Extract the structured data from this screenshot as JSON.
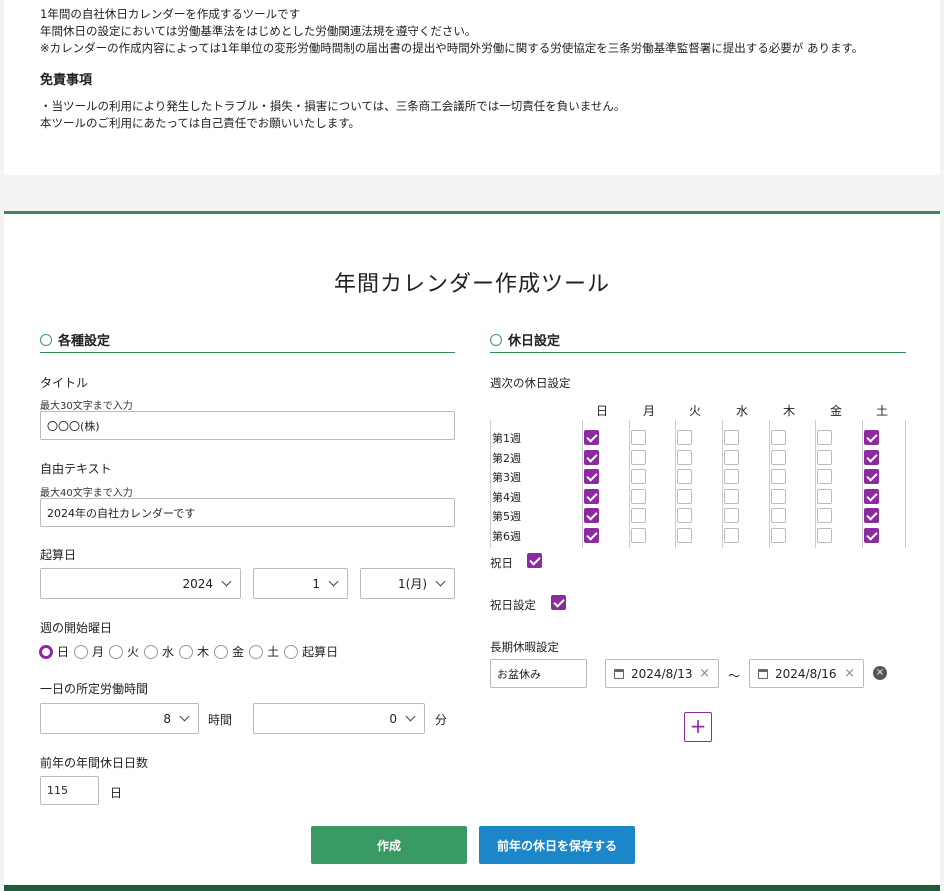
{
  "notice": {
    "lines": [
      "1年間の自社休日カレンダーを作成するツールです",
      "年間休日の設定においては労働基準法をはじめとした労働関連法規を遵守ください。",
      "※カレンダーの作成内容によっては1年単位の変形労働時間制の届出書の提出や時間外労働に関する労使協定を三条労働基準監督署に提出する必要が あります。"
    ],
    "disclaimer_title": "免責事項",
    "disclaimer_lines": [
      "・当ツールの利用により発生したトラブル・損失・損害については、三条商工会議所では一切責任を負いません。",
      "本ツールのご利用にあたっては自己責任でお願いいたします。"
    ]
  },
  "page_title": "年間カレンダー作成ツール",
  "settings": {
    "heading": "各種設定",
    "title_label": "タイトル",
    "title_hint": "最大30文字まで入力",
    "title_value": "〇〇〇(株)",
    "free_text_label": "自由テキスト",
    "free_text_hint": "最大40文字まで入力",
    "free_text_value": "2024年の自社カレンダーです",
    "start_date_label": "起算日",
    "start_year": "2024",
    "start_month": "1",
    "start_day": "1(月)",
    "week_start_label": "週の開始曜日",
    "week_start_options": [
      "日",
      "月",
      "火",
      "水",
      "木",
      "金",
      "土",
      "起算日"
    ],
    "week_start_selected": "日",
    "work_hours_label": "一日の所定労働時間",
    "work_hours_value": "8",
    "work_hours_unit": "時間",
    "work_minutes_value": "0",
    "work_minutes_unit": "分",
    "prev_holidays_label": "前年の年間休日日数",
    "prev_holidays_value": "115",
    "prev_holidays_unit": "日"
  },
  "holidays": {
    "heading": "休日設定",
    "weekly_label": "週次の休日設定",
    "days": [
      "日",
      "月",
      "火",
      "水",
      "木",
      "金",
      "土"
    ],
    "weeks": [
      {
        "label": "第1週",
        "checked": [
          true,
          false,
          false,
          false,
          false,
          false,
          true
        ]
      },
      {
        "label": "第2週",
        "checked": [
          true,
          false,
          false,
          false,
          false,
          false,
          true
        ]
      },
      {
        "label": "第3週",
        "checked": [
          true,
          false,
          false,
          false,
          false,
          false,
          true
        ]
      },
      {
        "label": "第4週",
        "checked": [
          true,
          false,
          false,
          false,
          false,
          false,
          true
        ]
      },
      {
        "label": "第5週",
        "checked": [
          true,
          false,
          false,
          false,
          false,
          false,
          true
        ]
      },
      {
        "label": "第6週",
        "checked": [
          true,
          false,
          false,
          false,
          false,
          false,
          true
        ]
      }
    ],
    "national_holiday_label": "祝日",
    "national_holiday_checked": true,
    "holiday_setting_label": "祝日設定",
    "holiday_setting_checked": true,
    "long_leave_label": "長期休暇設定",
    "long_leave_name": "お盆休み",
    "long_leave_from": "2024/8/13",
    "range_separator": "〜",
    "long_leave_to": "2024/8/16"
  },
  "buttons": {
    "create": "作成",
    "save_prev": "前年の休日を保存する"
  },
  "colors": {
    "accent_green": "#3b8a5a",
    "create_button": "#3a9a63",
    "save_button": "#1b86c8",
    "checkbox_purple": "#8e2aa0"
  }
}
